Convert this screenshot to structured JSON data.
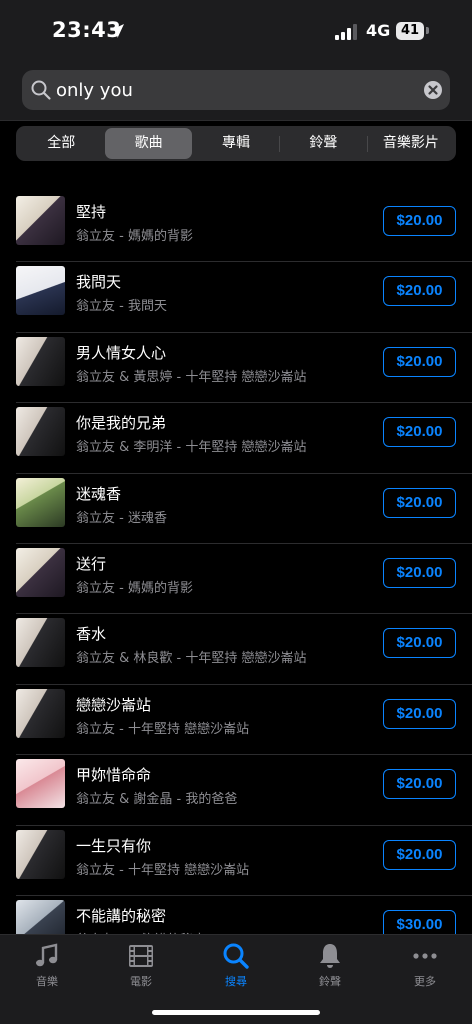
{
  "status": {
    "time": "23:43",
    "network": "4G",
    "battery": "41"
  },
  "search": {
    "value": "only you",
    "placeholder": ""
  },
  "segments": [
    {
      "label": "全部",
      "selected": false
    },
    {
      "label": "歌曲",
      "selected": true
    },
    {
      "label": "專輯",
      "selected": false
    },
    {
      "label": "鈴聲",
      "selected": false
    },
    {
      "label": "音樂影片",
      "selected": false
    }
  ],
  "songs": [
    {
      "title": "堅持",
      "subtitle": "翁立友 - 媽媽的背影",
      "price": "$20.00"
    },
    {
      "title": "我問天",
      "subtitle": "翁立友 - 我問天",
      "price": "$20.00"
    },
    {
      "title": "男人情女人心",
      "subtitle": "翁立友 & 黃思婷 - 十年堅持 戀戀沙崙站",
      "price": "$20.00"
    },
    {
      "title": "你是我的兄弟",
      "subtitle": "翁立友 & 李明洋 - 十年堅持 戀戀沙崙站",
      "price": "$20.00"
    },
    {
      "title": "迷魂香",
      "subtitle": "翁立友 - 迷魂香",
      "price": "$20.00"
    },
    {
      "title": "送行",
      "subtitle": "翁立友 - 媽媽的背影",
      "price": "$20.00"
    },
    {
      "title": "香水",
      "subtitle": "翁立友 & 林良歡 - 十年堅持 戀戀沙崙站",
      "price": "$20.00"
    },
    {
      "title": "戀戀沙崙站",
      "subtitle": "翁立友 - 十年堅持 戀戀沙崙站",
      "price": "$20.00"
    },
    {
      "title": "甲妳惜命命",
      "subtitle": "翁立友 & 謝金晶 - 我的爸爸",
      "price": "$20.00"
    },
    {
      "title": "一生只有你",
      "subtitle": "翁立友 - 十年堅持 戀戀沙崙站",
      "price": "$20.00"
    },
    {
      "title": "不能講的秘密",
      "subtitle": "翁立友 - 不能講的秘密",
      "price": "$30.00"
    }
  ],
  "tabs": [
    {
      "label": "音樂",
      "icon": "music-note-icon",
      "active": false
    },
    {
      "label": "電影",
      "icon": "film-icon",
      "active": false
    },
    {
      "label": "搜尋",
      "icon": "search-icon",
      "active": true
    },
    {
      "label": "鈴聲",
      "icon": "bell-icon",
      "active": false
    },
    {
      "label": "更多",
      "icon": "more-icon",
      "active": false
    }
  ],
  "colors": {
    "accent": "#0a84ff",
    "background": "#000000",
    "bar": "#1c1c1e"
  }
}
